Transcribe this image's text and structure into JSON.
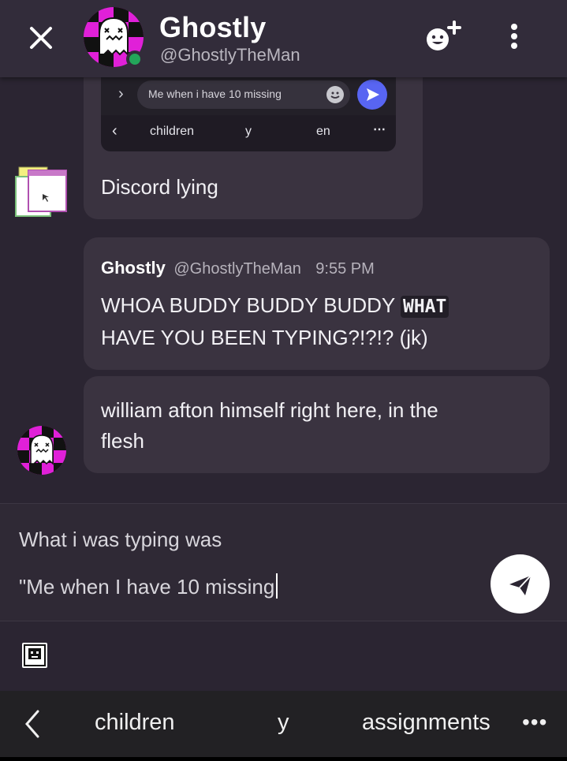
{
  "header": {
    "name": "Ghostly",
    "handle": "@GhostlyTheMan",
    "status_color": "#23a55a"
  },
  "messages": {
    "embed": {
      "input_text": "Me when i have 10 missing",
      "suggestions": [
        "children",
        "y",
        "en"
      ],
      "send_color": "#5865f2"
    },
    "message_1": {
      "text": "Discord lying"
    },
    "message_2": {
      "author": "Ghostly",
      "handle": "@GhostlyTheMan",
      "time": "9:55 PM",
      "text_before": "WHOA BUDDY BUDDY BUDDY ",
      "code": "WHAT",
      "text_after": "HAVE YOU BEEN TYPING?!?!? (jk)"
    },
    "message_3": {
      "line1": "william afton himself right here, in the",
      "line2": "flesh"
    }
  },
  "composer": {
    "line1": "What i was typing was",
    "line2": "\"Me when I have 10 missing"
  },
  "keyboard": {
    "suggestions": [
      "children",
      "y",
      "assignments"
    ]
  },
  "icons": {
    "close": "close-icon",
    "add_reaction": "add-reaction-icon",
    "more": "more-vertical-icon",
    "send": "paper-plane-icon",
    "sticker": "sticker-icon",
    "back": "chevron-left-icon"
  }
}
